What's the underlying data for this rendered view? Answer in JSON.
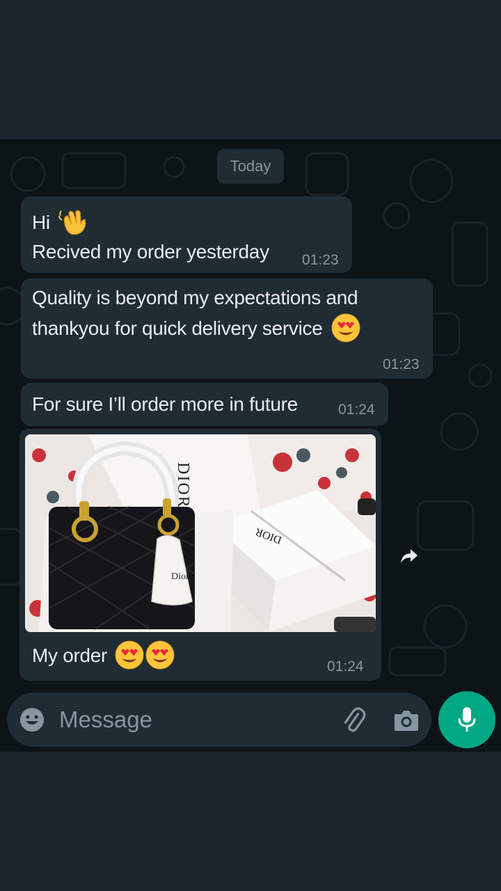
{
  "chat": {
    "date_divider": "Today",
    "messages": [
      {
        "line1": "Hi",
        "line1_emoji": "waving-hand-emoji",
        "line2": "Recived my order yesterday",
        "time": "01:23"
      },
      {
        "line1": "Quality is beyond my expectations and",
        "line2": "thankyou for quick delivery service",
        "emoji": "heart-eyes-emoji",
        "time": "01:23"
      },
      {
        "text": "For sure I’ll order more in future",
        "time": "01:24"
      },
      {
        "image": "photo of a black quilted handbag with gold charms next to white DIOR boxes",
        "caption": "My order",
        "emoji": "heart-eyes-emoji x2",
        "time": "01:24"
      }
    ]
  },
  "input": {
    "placeholder": "Message",
    "icons": [
      "emoji-icon",
      "attach-icon",
      "camera-icon",
      "mic-icon"
    ]
  },
  "colors": {
    "background": "#0d1418",
    "bubble": "#1f2c34",
    "text": "#e9edef",
    "meta": "#8696a0",
    "accent": "#00a884"
  }
}
